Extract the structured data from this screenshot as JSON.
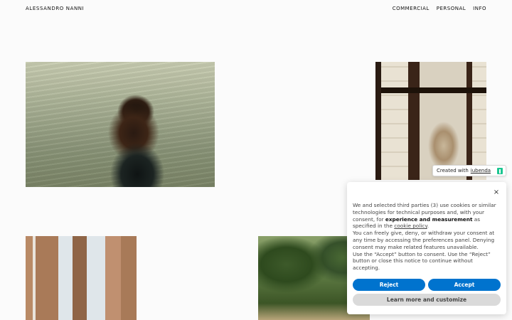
{
  "site": {
    "name": "ALESSANDRO NANNI"
  },
  "nav": {
    "items": [
      "COMMERCIAL",
      "PERSONAL",
      "INFO"
    ]
  },
  "iubenda_badge": {
    "prefix": "Created with",
    "brand": "iubenda"
  },
  "cookie_banner": {
    "close_glyph": "×",
    "line1_pre": "We and selected third parties (3) use cookies or similar technologies for technical purposes and, with your consent, for ",
    "line1_bold": "experience and measurement",
    "line1_post": " as specified in the ",
    "policy_link": "cookie policy",
    "line1_end": ".",
    "line2": "You can freely give, deny, or withdraw your consent at any time by accessing the preferences panel. Denying consent may make related features unavailable.",
    "line3": "Use the “Accept” button to consent. Use the “Reject” button or close this notice to continue without accepting.",
    "reject_label": "Reject",
    "accept_label": "Accept",
    "customize_label": "Learn more and customize"
  },
  "colors": {
    "primary_button": "#0073ce",
    "secondary_button": "#dadada",
    "iubenda_green": "#1cc691"
  }
}
